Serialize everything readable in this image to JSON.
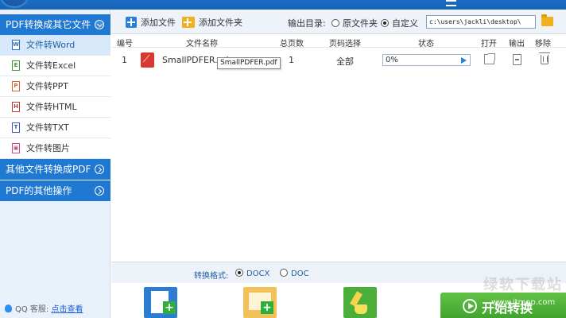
{
  "sidebar": {
    "categories": [
      {
        "label": "PDF转换成其它文件"
      },
      {
        "label": "其他文件转换成PDF"
      },
      {
        "label": "PDF的其他操作"
      }
    ],
    "items": [
      {
        "label": "文件转Word",
        "icon": "W"
      },
      {
        "label": "文件转Excel",
        "icon": "E"
      },
      {
        "label": "文件转PPT",
        "icon": "P"
      },
      {
        "label": "文件转HTML",
        "icon": "H"
      },
      {
        "label": "文件转TXT",
        "icon": "T"
      },
      {
        "label": "文件转图片",
        "icon": "▣"
      }
    ],
    "support": {
      "prefix": "QQ 客服:",
      "link": "点击查看"
    }
  },
  "toolbar": {
    "add_file": "添加文件",
    "add_folder": "添加文件夹",
    "output_label": "输出目录:",
    "opt_original": "原文件夹",
    "opt_custom": "自定义",
    "path": "c:\\users\\jackli\\desktop\\"
  },
  "table": {
    "headers": {
      "num": "编号",
      "name": "文件名称",
      "pages": "总页数",
      "range": "页码选择",
      "status": "状态",
      "open": "打开",
      "output": "输出",
      "remove": "移除"
    },
    "rows": [
      {
        "num": "1",
        "name": "SmallPDFER.pd",
        "pages": "1",
        "range": "全部",
        "progress": "0%"
      }
    ],
    "tooltip": "SmallPDFER.pdf"
  },
  "format": {
    "label": "转换格式:",
    "opt_docx": "DOCX",
    "opt_doc": "DOC"
  },
  "start_label": "开始转换",
  "watermark": {
    "text": "绿软下载站",
    "url": "www.itmop.com"
  },
  "colors": {
    "primary": "#1f78d1",
    "start": "#4cb034",
    "pdf": "#d9372f"
  }
}
